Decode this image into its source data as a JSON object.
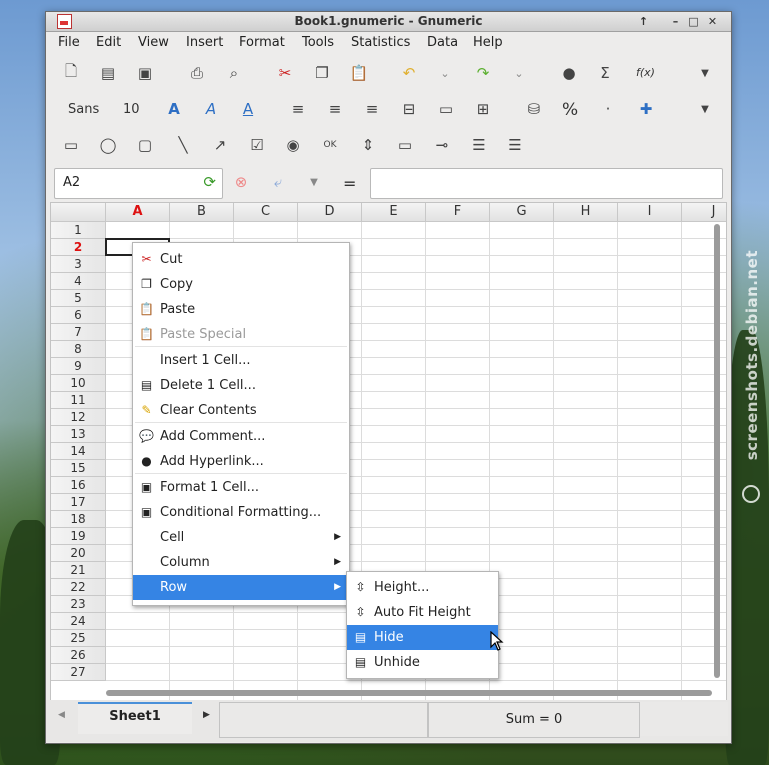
{
  "window": {
    "title": "Book1.gnumeric - Gnumeric"
  },
  "menubar": [
    "File",
    "Edit",
    "View",
    "Insert",
    "Format",
    "Tools",
    "Statistics",
    "Data",
    "Help"
  ],
  "toolbar": {
    "font_name": "Sans",
    "font_size": "10",
    "percent": "%",
    "fx": "f(x)"
  },
  "namebox": {
    "value": "A2"
  },
  "formula_bar": {
    "equals": "=",
    "value": ""
  },
  "columns": [
    "A",
    "B",
    "C",
    "D",
    "E",
    "F",
    "G",
    "H",
    "I",
    "J"
  ],
  "rows": [
    "1",
    "2",
    "3",
    "4",
    "5",
    "6",
    "7",
    "8",
    "9",
    "10",
    "11",
    "12",
    "13",
    "14",
    "15",
    "16",
    "17",
    "18",
    "19",
    "20",
    "21",
    "22",
    "23",
    "24",
    "25",
    "26",
    "27"
  ],
  "selection": {
    "column": "A",
    "row": "2"
  },
  "context_menu": {
    "items": [
      {
        "label": "Cut",
        "icon": "scissors-icon"
      },
      {
        "label": "Copy",
        "icon": "copy-icon"
      },
      {
        "label": "Paste",
        "icon": "paste-icon"
      },
      {
        "label": "Paste Special",
        "icon": "paste-special-icon",
        "disabled": true
      },
      {
        "label": "Insert 1 Cell..."
      },
      {
        "label": "Delete 1 Cell...",
        "icon": "delete-cell-icon"
      },
      {
        "label": "Clear Contents",
        "icon": "broom-icon"
      },
      {
        "label": "Add Comment...",
        "icon": "comment-icon"
      },
      {
        "label": "Add Hyperlink...",
        "icon": "hyperlink-icon"
      },
      {
        "label": "Format 1 Cell...",
        "icon": "format-cell-icon"
      },
      {
        "label": "Conditional Formatting...",
        "icon": "conditional-format-icon"
      },
      {
        "label": "Cell",
        "submenu": true
      },
      {
        "label": "Column",
        "submenu": true
      },
      {
        "label": "Row",
        "submenu": true,
        "highlighted": true
      }
    ]
  },
  "row_submenu": {
    "items": [
      {
        "label": "Height...",
        "icon": "row-height-icon"
      },
      {
        "label": "Auto Fit Height",
        "icon": "auto-fit-icon"
      },
      {
        "label": "Hide",
        "icon": "hide-row-icon",
        "highlighted": true
      },
      {
        "label": "Unhide",
        "icon": "unhide-row-icon"
      }
    ]
  },
  "statusbar": {
    "sheet_tab": "Sheet1",
    "sum": "Sum = 0"
  },
  "watermark": "screenshots.debian.net",
  "colors": {
    "accent": "#3584e4",
    "selected_header": "#dd1111"
  }
}
